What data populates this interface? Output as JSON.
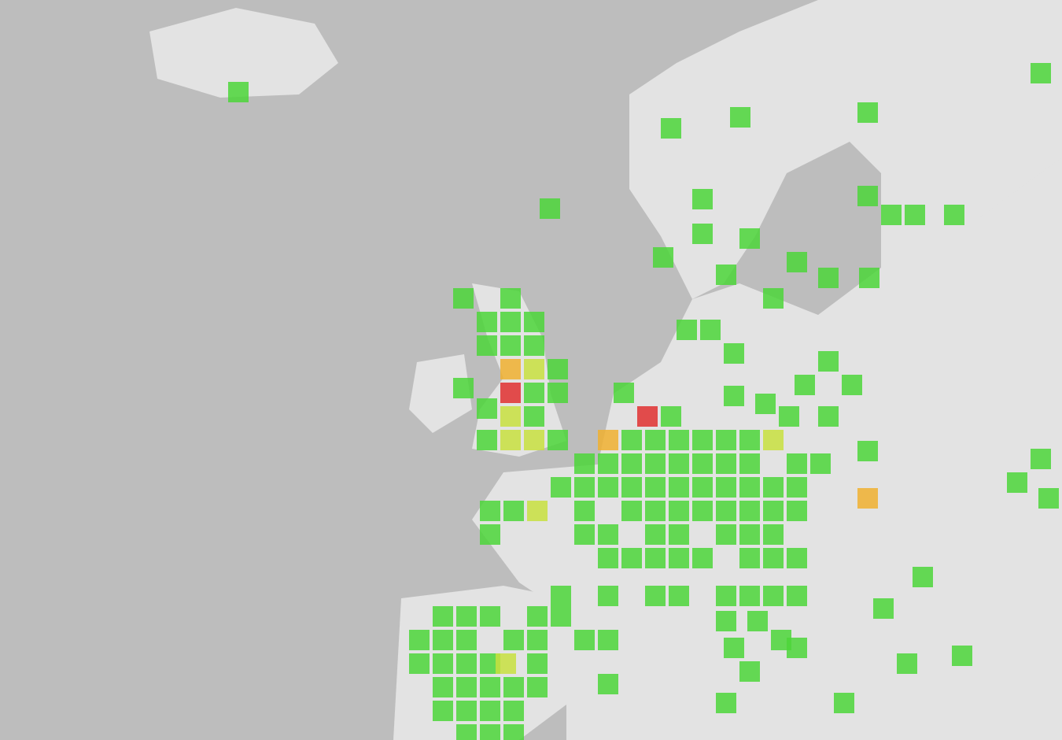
{
  "map": {
    "kind": "heatmap-grid"
  }
}
